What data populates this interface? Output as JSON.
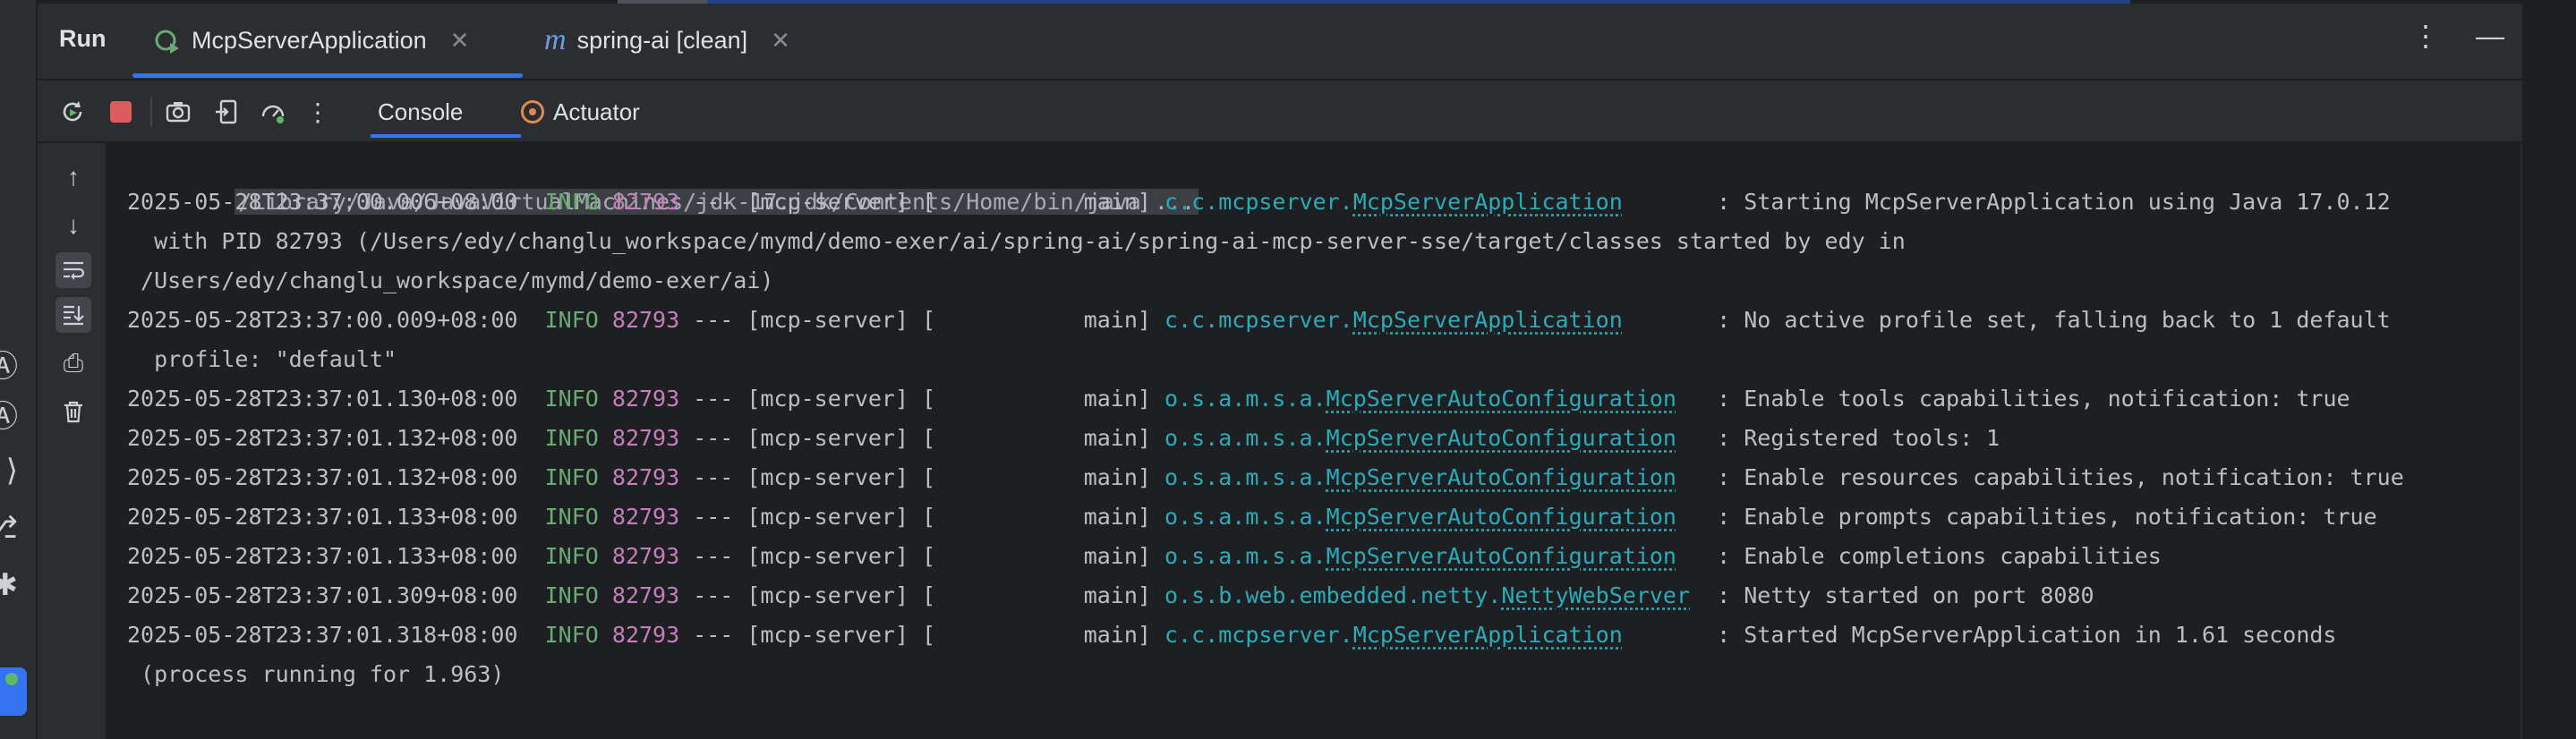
{
  "header": {
    "title": "Run",
    "tabs": [
      {
        "label": "McpServerApplication",
        "icon": "spring-boot-run-icon",
        "active": true
      },
      {
        "label": "spring-ai [clean]",
        "icon": "maven-icon",
        "active": false
      }
    ],
    "tab2_icon_glyph": "m",
    "actions": [
      {
        "name": "more-options-icon",
        "glyph": "⋮"
      },
      {
        "name": "minimize-icon",
        "glyph": "—"
      }
    ]
  },
  "toolbar": {
    "buttons": [
      {
        "name": "rerun-icon",
        "glyph": "↻"
      },
      {
        "name": "stop-icon",
        "glyph": ""
      },
      {
        "name": "screenshot-icon",
        "glyph": "◉"
      },
      {
        "name": "exit-icon",
        "glyph": "⇥"
      },
      {
        "name": "profiler-icon",
        "glyph": "◔"
      },
      {
        "name": "more-icon",
        "glyph": "⋮"
      }
    ],
    "subtabs": [
      {
        "label": "Console",
        "active": true
      },
      {
        "label": "Actuator",
        "active": false
      }
    ]
  },
  "gutter": [
    {
      "name": "scroll-up-icon",
      "glyph": "↑"
    },
    {
      "name": "scroll-down-icon",
      "glyph": "↓"
    },
    {
      "name": "soft-wrap-icon",
      "glyph": "⤶"
    },
    {
      "name": "scroll-to-end-icon",
      "glyph": "⤓"
    },
    {
      "name": "print-icon",
      "glyph": "⎙"
    },
    {
      "name": "clear-all-icon",
      "glyph": "🗑"
    }
  ],
  "console": {
    "command": "/Library/Java/JavaVirtualMachines/jdk-17.jdk/Contents/Home/bin/java ...",
    "logs": [
      {
        "ts": "2025-05-28T23:37:00.006+08:00",
        "level": "INFO",
        "pid": "82793",
        "mid": " --- [mcp-server] [           main] ",
        "pkg": "c.c.mcpserver.",
        "cls": "McpServerApplication",
        "pad": "       ",
        "msg": ": Starting McpServerApplication using Java 17.0.12"
      },
      {
        "cont": "  with PID 82793 (/Users/edy/changlu_workspace/mymd/demo-exer/ai/spring-ai/spring-ai-mcp-server-sse/target/classes started by edy in"
      },
      {
        "cont": " /Users/edy/changlu_workspace/mymd/demo-exer/ai)"
      },
      {
        "ts": "2025-05-28T23:37:00.009+08:00",
        "level": "INFO",
        "pid": "82793",
        "mid": " --- [mcp-server] [           main] ",
        "pkg": "c.c.mcpserver.",
        "cls": "McpServerApplication",
        "pad": "       ",
        "msg": ": No active profile set, falling back to 1 default"
      },
      {
        "cont": "  profile: \"default\""
      },
      {
        "ts": "2025-05-28T23:37:01.130+08:00",
        "level": "INFO",
        "pid": "82793",
        "mid": " --- [mcp-server] [           main] ",
        "pkg": "o.s.a.m.s.a.",
        "cls": "McpServerAutoConfiguration",
        "pad": "   ",
        "msg": ": Enable tools capabilities, notification: true"
      },
      {
        "ts": "2025-05-28T23:37:01.132+08:00",
        "level": "INFO",
        "pid": "82793",
        "mid": " --- [mcp-server] [           main] ",
        "pkg": "o.s.a.m.s.a.",
        "cls": "McpServerAutoConfiguration",
        "pad": "   ",
        "msg": ": Registered tools: 1"
      },
      {
        "ts": "2025-05-28T23:37:01.132+08:00",
        "level": "INFO",
        "pid": "82793",
        "mid": " --- [mcp-server] [           main] ",
        "pkg": "o.s.a.m.s.a.",
        "cls": "McpServerAutoConfiguration",
        "pad": "   ",
        "msg": ": Enable resources capabilities, notification: true"
      },
      {
        "ts": "2025-05-28T23:37:01.133+08:00",
        "level": "INFO",
        "pid": "82793",
        "mid": " --- [mcp-server] [           main] ",
        "pkg": "o.s.a.m.s.a.",
        "cls": "McpServerAutoConfiguration",
        "pad": "   ",
        "msg": ": Enable prompts capabilities, notification: true"
      },
      {
        "ts": "2025-05-28T23:37:01.133+08:00",
        "level": "INFO",
        "pid": "82793",
        "mid": " --- [mcp-server] [           main] ",
        "pkg": "o.s.a.m.s.a.",
        "cls": "McpServerAutoConfiguration",
        "pad": "   ",
        "msg": ": Enable completions capabilities"
      },
      {
        "ts": "2025-05-28T23:37:01.309+08:00",
        "level": "INFO",
        "pid": "82793",
        "mid": " --- [mcp-server] [           main] ",
        "pkg": "o.s.b.web.embedded.netty.",
        "cls": "NettyWebServer",
        "pad": "  ",
        "msg": ": Netty started on port 8080"
      },
      {
        "ts": "2025-05-28T23:37:01.318+08:00",
        "level": "INFO",
        "pid": "82793",
        "mid": " --- [mcp-server] [           main] ",
        "pkg": "c.c.mcpserver.",
        "cls": "McpServerApplication",
        "pad": "       ",
        "msg": ": Started McpServerApplication in 1.61 seconds"
      },
      {
        "cont": " (process running for 1.963)"
      }
    ]
  },
  "colors": {
    "accent": "#3574f0",
    "info": "#6aab73",
    "pid": "#c77dbb",
    "logger": "#2aacb8",
    "stop": "#db5c5c"
  }
}
